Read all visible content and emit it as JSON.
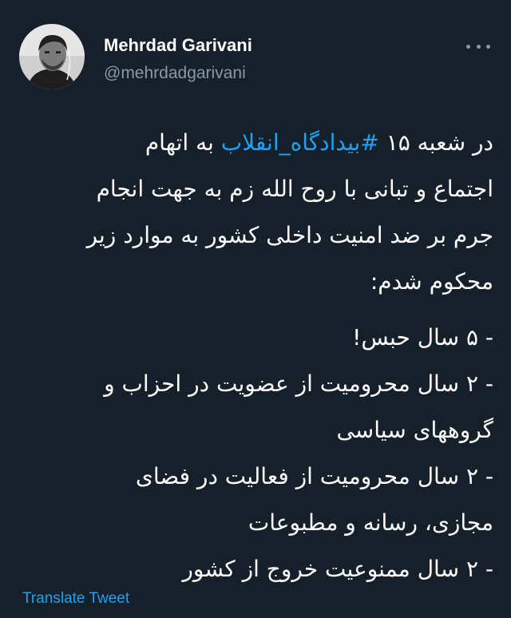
{
  "author": {
    "name": "Mehrdad Garivani",
    "handle": "@mehrdadgarivani"
  },
  "menu": {
    "icon": "more-horizontal-icon"
  },
  "tweet": {
    "line1_pre": "در شعبه ۱۵ ",
    "line1_hashtag": "#بیدادگاه_انقلاب",
    "line1_post": " به اتهام",
    "line2": "اجتماع و تبانی با روح الله زم به جهت انجام",
    "line3": "جرم بر ضد امنیت داخلی کشور به موارد زیر",
    "line4": "محکوم شدم:",
    "item1": "- ۵ سال حبس!",
    "item2_line1": "- ۲ سال محرومیت از عضویت در احزاب و",
    "item2_line2": "گروههای سیاسی",
    "item3_line1": "- ۲ سال محرومیت از فعالیت در فضای",
    "item3_line2": "مجازی، رسانه و مطبوعات",
    "item4": "- ۲ سال ممنوعیت خروج از کشور"
  },
  "translate_label": "Translate Tweet",
  "colors": {
    "background": "#15202b",
    "text": "#ffffff",
    "secondary": "#8899a6",
    "accent": "#1da1f2"
  }
}
